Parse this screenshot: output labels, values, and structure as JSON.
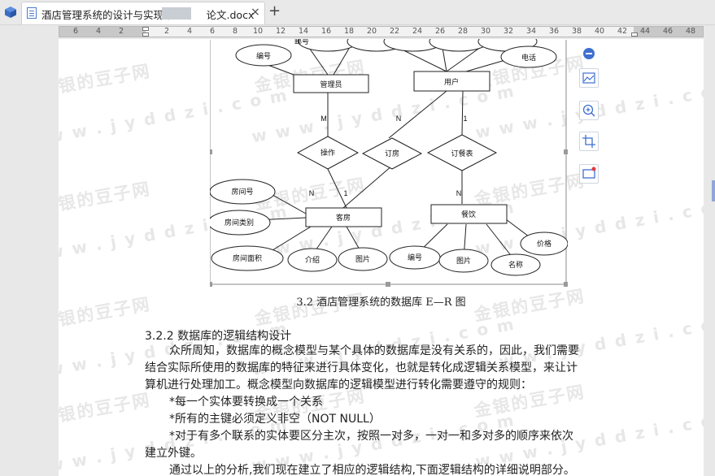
{
  "tab": {
    "title": "酒店管理系统的设计与实现毕",
    "title_tail": "论文.docx",
    "close_glyph": "×",
    "new_tab_glyph": "+"
  },
  "ruler": {
    "ticks": [
      "6",
      "4",
      "2",
      "2",
      "4",
      "6",
      "8",
      "10",
      "12",
      "14",
      "16",
      "18",
      "20",
      "22",
      "24",
      "26",
      "28",
      "30",
      "32",
      "34",
      "36",
      "38",
      "40",
      "42",
      "44",
      "46",
      "48"
    ]
  },
  "watermark": {
    "cn": "金银的豆子网",
    "url": "w w w . j y d d z i . c o m"
  },
  "diagram": {
    "entities": [
      "管理员",
      "用户",
      "客房",
      "餐饮"
    ],
    "relationships": [
      "操作",
      "订房",
      "订餐表"
    ],
    "attributes": [
      "编号",
      "电话",
      "房间号",
      "房间类别",
      "房间面积",
      "介绍",
      "图片",
      "编号",
      "图片",
      "名称",
      "价格"
    ],
    "cardinalities": [
      "M",
      "N",
      "1",
      "N",
      "1",
      "N"
    ],
    "partial_top_label": "邮号"
  },
  "caption": "3.2 酒店管理系统的数据库 E—R 图",
  "heading": "3.2.2 数据库的逻辑结构设计",
  "paragraphs": [
    "众所周知，数据库的概念模型与某个具体的数据库是没有关系的，因此，我们需要",
    "结合实际所使用的数据库的特征来进行具体变化，也就是转化成逻辑关系模型，来让计",
    "算机进行处理加工。概念模型向数据库的逻辑模型进行转化需要遵守的规则：",
    "*每一个实体要转换成一个关系",
    "*所有的主键必须定义非空（NOT NULL）",
    "*对于有多个联系的实体要区分主次，按照一对多，一对一和多对多的顺序来依次",
    "建立外键。",
    "通过以上的分析,我们现在建立了相应的逻辑结构,下面逻辑结构的详细说明部分。"
  ]
}
